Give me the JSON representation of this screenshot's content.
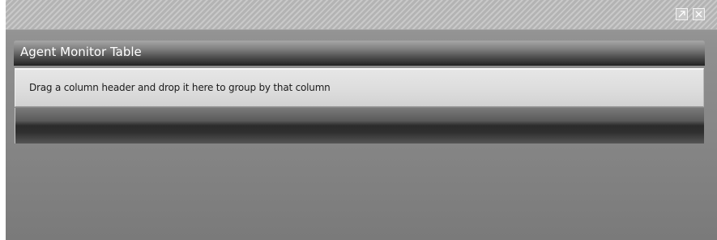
{
  "window": {
    "controls": {
      "popout_icon": "popout-arrow-icon",
      "close_icon": "close-x-icon"
    }
  },
  "panel": {
    "title": "Agent Monitor Table",
    "group_hint": "Drag a column header and drop it here to group by that column"
  },
  "colors": {
    "header_dark": "#222222",
    "group_area_bg": "#dcdcdc",
    "window_bg": "#8f8f8f",
    "title_text": "#ffffff"
  }
}
